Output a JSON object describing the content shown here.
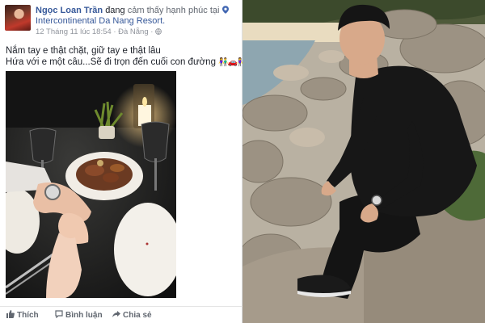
{
  "post": {
    "author": "Ngọc Loan Trần",
    "feeling_prefix": "đang",
    "feeling": "cảm thấy hạnh phúc tại",
    "place": "Intercontinental Da Nang Resort.",
    "timestamp": "12 Tháng 11 lúc 18:54",
    "location": "Đà Nẵng",
    "separator": "·",
    "message": [
      "Nắm tay e thật chặt, giữ tay e thật lâu",
      "Hứa với e một câu...Sẽ đi trọn đến cuối con đường"
    ],
    "message_emoji": "👫🚗👫"
  },
  "actions": {
    "like": "Thích",
    "comment": "Bình luận",
    "share": "Chia sẻ"
  },
  "icons": {
    "location": "map-pin-icon",
    "privacy": "globe-icon",
    "like": "thumbs-up-icon",
    "comment": "speech-bubble-icon",
    "share": "share-arrow-icon"
  },
  "colors": {
    "link": "#365899",
    "text": "#1d2129",
    "muted": "#90949c",
    "action": "#616770"
  }
}
